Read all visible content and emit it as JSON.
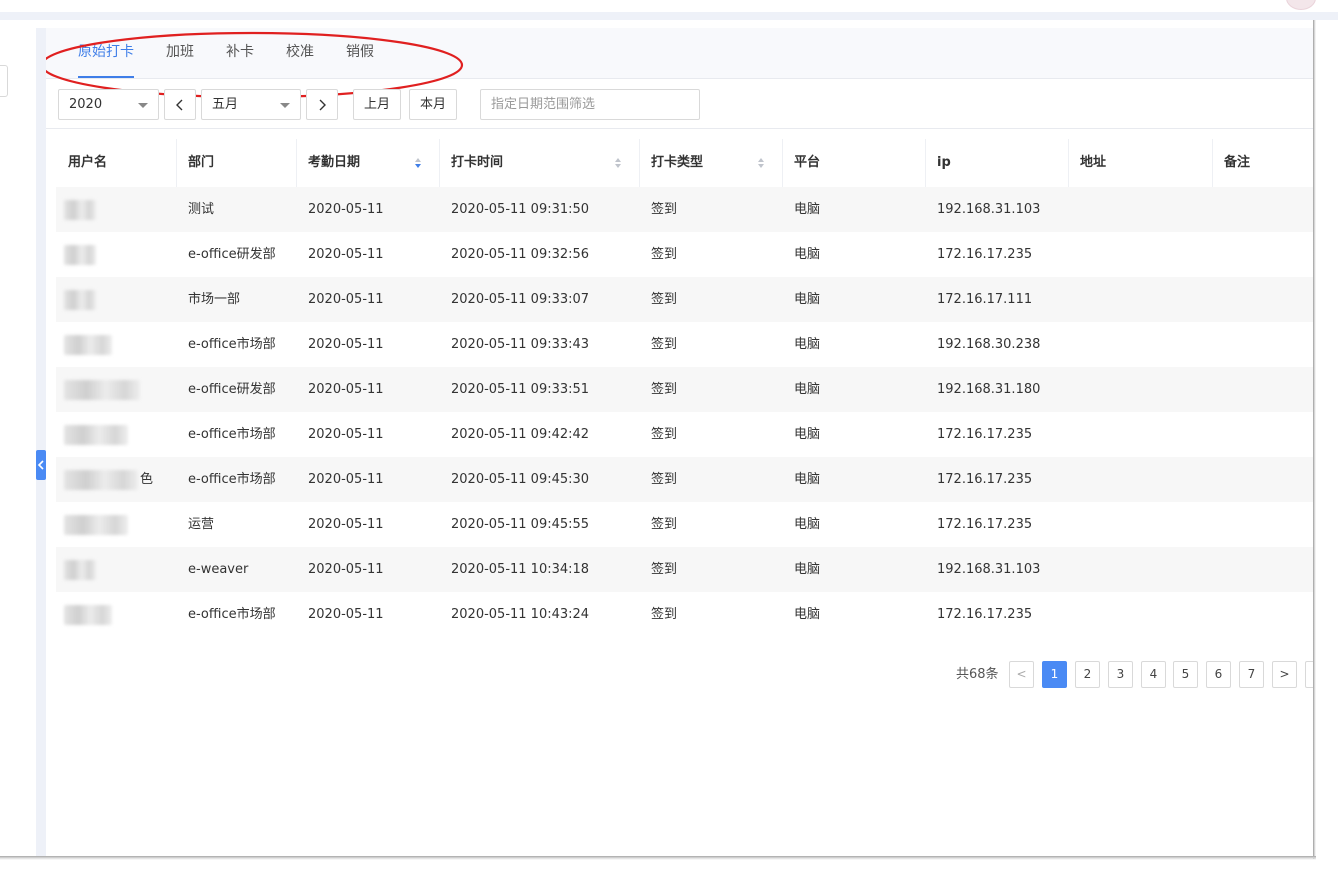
{
  "tabs": [
    {
      "label": "原始打卡",
      "active": true
    },
    {
      "label": "加班",
      "active": false
    },
    {
      "label": "补卡",
      "active": false
    },
    {
      "label": "校准",
      "active": false
    },
    {
      "label": "销假",
      "active": false
    }
  ],
  "filters": {
    "year": "2020",
    "month": "五月",
    "prev_month_label": "上月",
    "this_month_label": "本月",
    "date_range_placeholder": "指定日期范围筛选"
  },
  "table": {
    "columns": [
      "用户名",
      "部门",
      "考勤日期",
      "打卡时间",
      "打卡类型",
      "平台",
      "ip",
      "地址",
      "备注"
    ],
    "rows": [
      {
        "dept": "测试",
        "date": "2020-05-11",
        "time": "2020-05-11 09:31:50",
        "type": "签到",
        "platform": "电脑",
        "ip": "192.168.31.103"
      },
      {
        "dept": "e-office研发部",
        "date": "2020-05-11",
        "time": "2020-05-11 09:32:56",
        "type": "签到",
        "platform": "电脑",
        "ip": "172.16.17.235"
      },
      {
        "dept": "市场一部",
        "date": "2020-05-11",
        "time": "2020-05-11 09:33:07",
        "type": "签到",
        "platform": "电脑",
        "ip": "172.16.17.111"
      },
      {
        "dept": "e-office市场部",
        "date": "2020-05-11",
        "time": "2020-05-11 09:33:43",
        "type": "签到",
        "platform": "电脑",
        "ip": "192.168.30.238"
      },
      {
        "dept": "e-office研发部",
        "date": "2020-05-11",
        "time": "2020-05-11 09:33:51",
        "type": "签到",
        "platform": "电脑",
        "ip": "192.168.31.180"
      },
      {
        "dept": "e-office市场部",
        "date": "2020-05-11",
        "time": "2020-05-11 09:42:42",
        "type": "签到",
        "platform": "电脑",
        "ip": "172.16.17.235"
      },
      {
        "dept": "e-office市场部",
        "date": "2020-05-11",
        "time": "2020-05-11 09:45:30",
        "type": "签到",
        "platform": "电脑",
        "ip": "172.16.17.235",
        "name_tail": "色"
      },
      {
        "dept": "运营",
        "date": "2020-05-11",
        "time": "2020-05-11 09:45:55",
        "type": "签到",
        "platform": "电脑",
        "ip": "172.16.17.235"
      },
      {
        "dept": "e-weaver",
        "date": "2020-05-11",
        "time": "2020-05-11 10:34:18",
        "type": "签到",
        "platform": "电脑",
        "ip": "192.168.31.103"
      },
      {
        "dept": "e-office市场部",
        "date": "2020-05-11",
        "time": "2020-05-11 10:43:24",
        "type": "签到",
        "platform": "电脑",
        "ip": "172.16.17.235"
      }
    ]
  },
  "pagination": {
    "total_label": "共68条",
    "prev": "<",
    "next": ">",
    "pages": [
      "1",
      "2",
      "3",
      "4",
      "5",
      "6",
      "7"
    ],
    "current": "1"
  },
  "colors": {
    "accent": "#3f7ee8",
    "annotation": "#e02020",
    "row_stripe": "#f7f7f7"
  }
}
